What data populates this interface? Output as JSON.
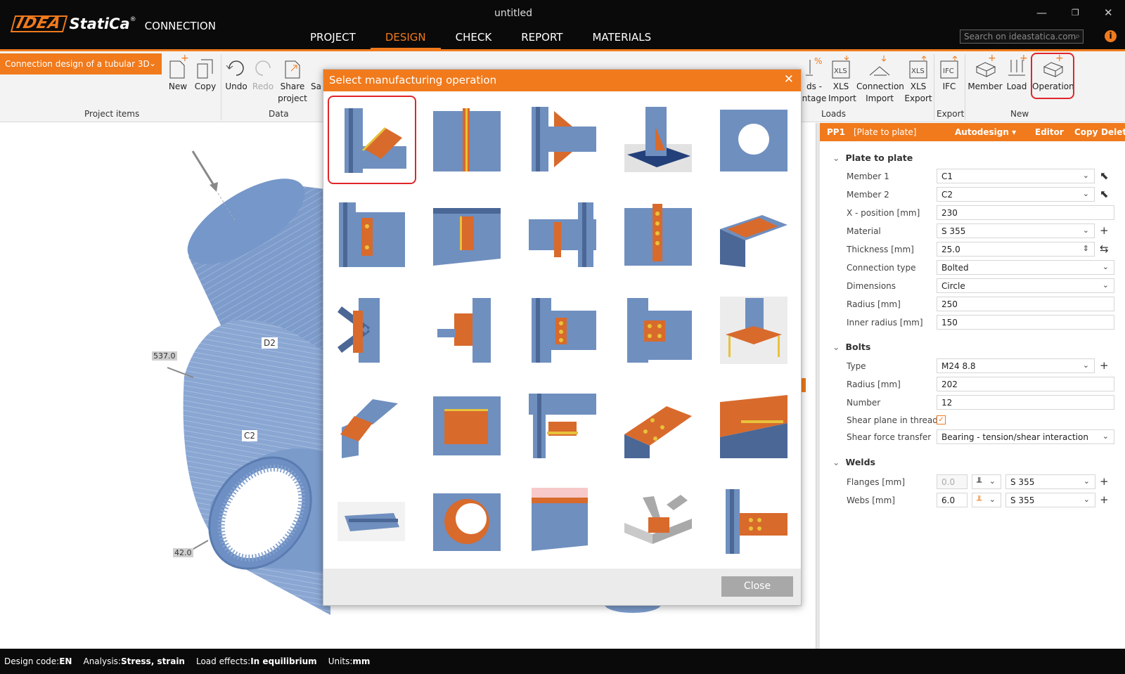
{
  "window": {
    "title": "untitled"
  },
  "logo": {
    "brand_a": "IDEA",
    "brand_b": "StatiCa",
    "product": "CONNECTION"
  },
  "menu": [
    "PROJECT",
    "DESIGN",
    "CHECK",
    "REPORT",
    "MATERIALS"
  ],
  "search": {
    "placeholder": "Search on ideastatica.com"
  },
  "ribbon": {
    "project_dropdown": "Connection design of a tubular 3D",
    "buttons": {
      "new": "New",
      "copy": "Copy",
      "undo": "Undo",
      "redo": "Redo",
      "share_1": "Share",
      "share_2": "project",
      "sa": "Sa",
      "loads_1": "ds -",
      "loads_2": "ntage",
      "xls_import_1": "XLS",
      "xls_import_2": "Import",
      "conn_import_1": "Connection",
      "conn_import_2": "Import",
      "xls_export_1": "XLS",
      "xls_export_2": "Export",
      "ifc": "IFC",
      "member": "Member",
      "load": "Load",
      "operation": "Operation"
    },
    "groups": {
      "project_items": "Project items",
      "data": "Data",
      "loads": "Loads",
      "export": "Export",
      "new": "New"
    }
  },
  "viewport": {
    "labels": {
      "d2": "D2",
      "c2": "C2",
      "dim1": "537.0",
      "dim2": "42.0"
    }
  },
  "panel": {
    "id": "PP1",
    "name": "[Plate to plate]",
    "actions": {
      "autodesign": "Autodesign",
      "editor": "Editor",
      "copy": "Copy",
      "delete": "Delete"
    },
    "sections": {
      "plate": "Plate to plate",
      "bolts": "Bolts",
      "welds": "Welds"
    },
    "plate": [
      {
        "label": "Member 1",
        "value": "C1"
      },
      {
        "label": "Member 2",
        "value": "C2"
      },
      {
        "label": "X - position [mm]",
        "value": "230"
      },
      {
        "label": "Material",
        "value": "S 355"
      },
      {
        "label": "Thickness [mm]",
        "value": "25.0"
      },
      {
        "label": "Connection type",
        "value": "Bolted"
      },
      {
        "label": "Dimensions",
        "value": "Circle"
      },
      {
        "label": "Radius [mm]",
        "value": "250"
      },
      {
        "label": "Inner radius [mm]",
        "value": "150"
      }
    ],
    "bolts": [
      {
        "label": "Type",
        "value": "M24 8.8"
      },
      {
        "label": "Radius [mm]",
        "value": "202"
      },
      {
        "label": "Number",
        "value": "12"
      },
      {
        "label": "Shear plane in thread",
        "value": "✓"
      },
      {
        "label": "Shear force transfer",
        "value": "Bearing - tension/shear interaction"
      }
    ],
    "welds": [
      {
        "label": "Flanges [mm]",
        "thickness": "0.0",
        "material": "S 355"
      },
      {
        "label": "Webs [mm]",
        "thickness": "6.0",
        "material": "S 355"
      }
    ]
  },
  "dialog": {
    "title": "Select manufacturing operation",
    "close": "Close",
    "tiles_count": 25
  },
  "status": {
    "design_code_label": "Design code:",
    "design_code": "EN",
    "analysis_label": "Analysis:",
    "analysis": "Stress, strain",
    "load_effects_label": "Load effects:",
    "load_effects": "In equilibrium",
    "units_label": "Units:",
    "units": "mm"
  },
  "colors": {
    "accent": "#f07a1c",
    "steel": "#6f8fbf",
    "plate": "#d86a2c",
    "highlight": "#e0262b"
  }
}
